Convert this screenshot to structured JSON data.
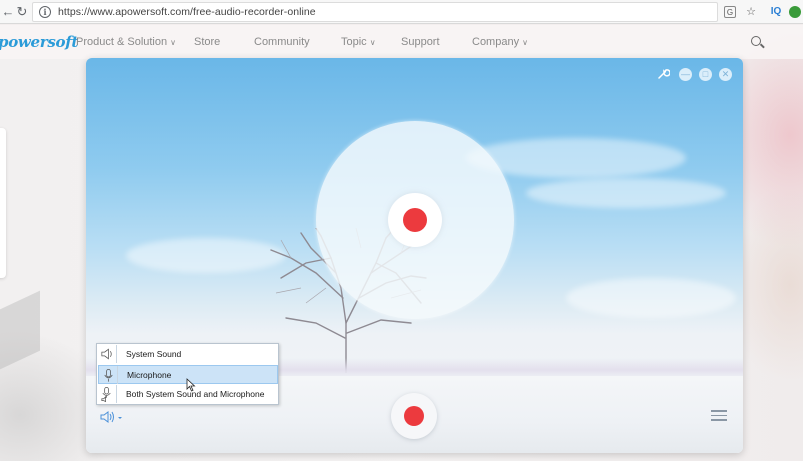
{
  "browser": {
    "url": "https://www.apowersoft.com/free-audio-recorder-online",
    "extensions": [
      "translate-icon",
      "bookmark-star-icon",
      "iq-extension-icon",
      "evernote-icon"
    ]
  },
  "site": {
    "logo": "powersoft",
    "nav": [
      {
        "label": "Product & Solution",
        "has_dropdown": true
      },
      {
        "label": "Store",
        "has_dropdown": false
      },
      {
        "label": "Community",
        "has_dropdown": false
      },
      {
        "label": "Topic",
        "has_dropdown": true
      },
      {
        "label": "Support",
        "has_dropdown": false
      },
      {
        "label": "Company",
        "has_dropdown": true
      }
    ]
  },
  "recorder": {
    "window_controls": [
      "settings-wrench",
      "minimize",
      "maximize",
      "close"
    ],
    "audio_source_menu": {
      "items": [
        {
          "label": "System Sound",
          "selected": false
        },
        {
          "label": "Microphone",
          "selected": true
        },
        {
          "label": "Both System Sound and Microphone",
          "selected": false
        }
      ]
    },
    "colors": {
      "record_red": "#ec3a3e",
      "accent_blue": "#2b9bd8",
      "menu_highlight": "#cce3f7"
    }
  }
}
